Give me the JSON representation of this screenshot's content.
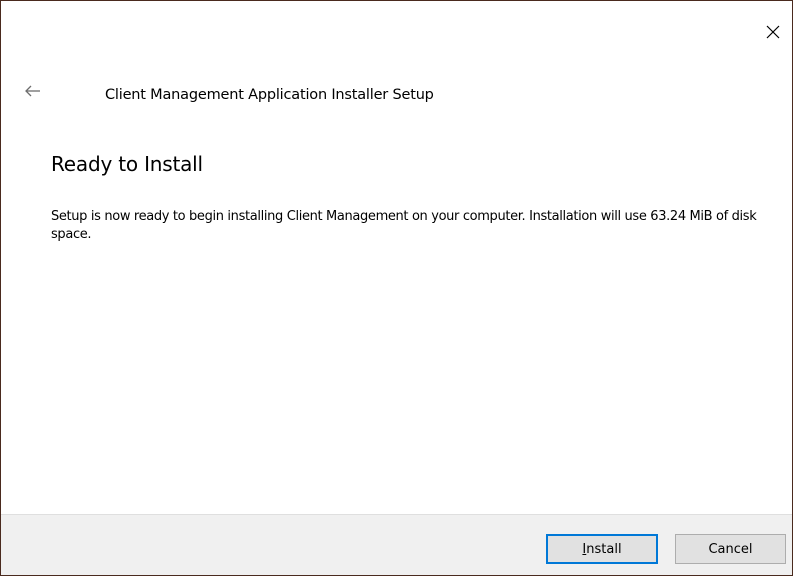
{
  "window": {
    "title": "Client Management Application Installer Setup",
    "close_glyph": "✕",
    "back_glyph": "←"
  },
  "page": {
    "heading": "Ready to Install",
    "description": "Setup is now ready to begin installing Client Management on your computer. Installation will use 63.24 MiB of disk space."
  },
  "buttons": {
    "install": {
      "accelerator": "I",
      "rest": "nstall",
      "is_default": true
    },
    "cancel": {
      "label": "Cancel"
    }
  },
  "colors": {
    "accent": "#0078d7",
    "footer_bg": "#f0f0f0",
    "button_bg": "#e1e1e1"
  }
}
